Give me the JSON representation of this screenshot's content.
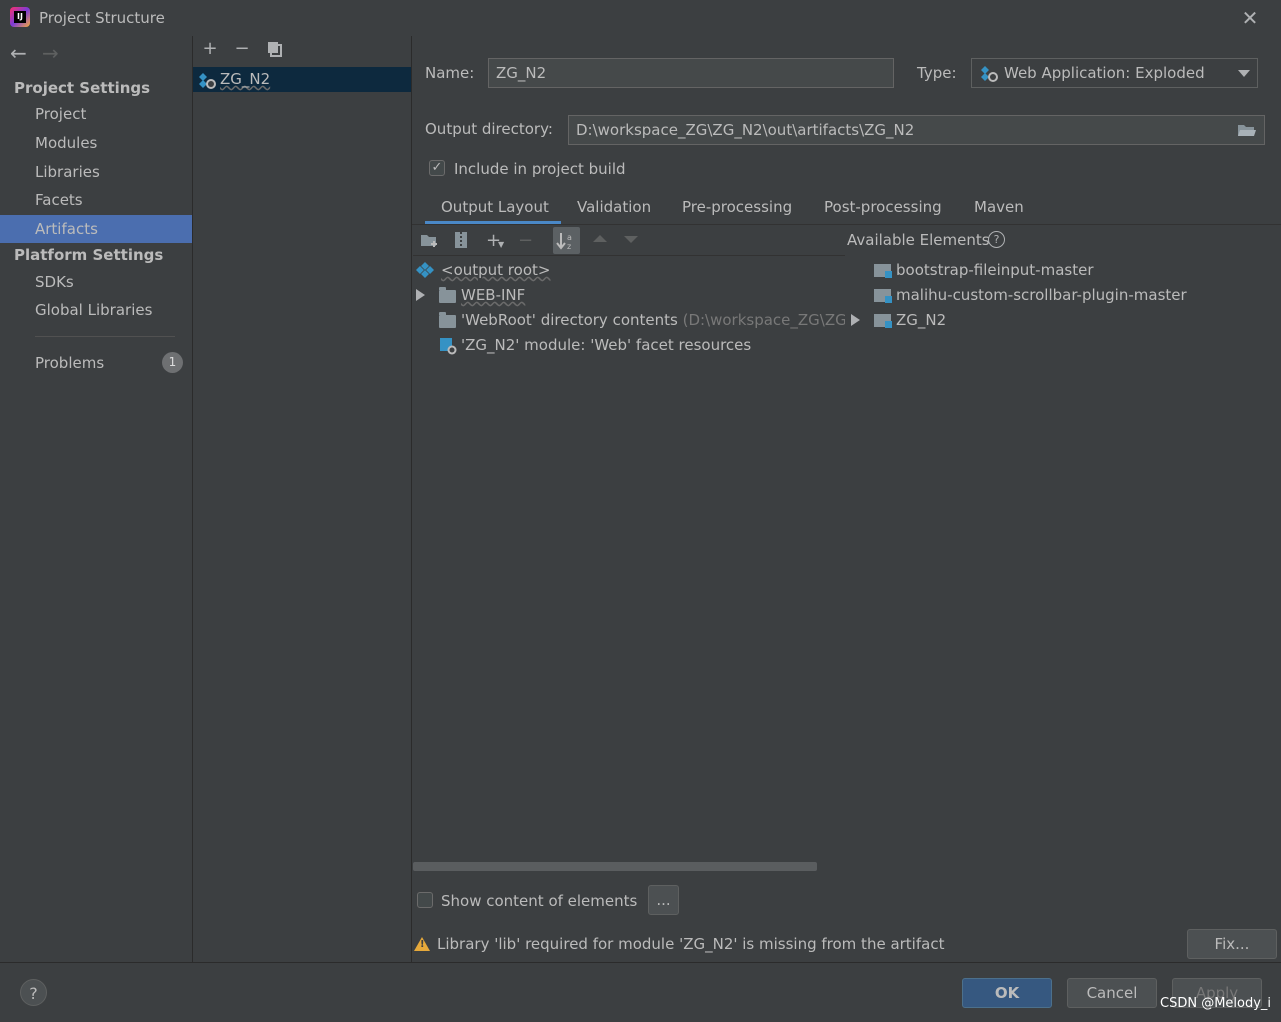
{
  "window": {
    "title": "Project Structure"
  },
  "sidebar": {
    "project_settings_header": "Project Settings",
    "project_items": [
      "Project",
      "Modules",
      "Libraries",
      "Facets",
      "Artifacts"
    ],
    "platform_settings_header": "Platform Settings",
    "platform_items": [
      "SDKs",
      "Global Libraries"
    ],
    "problems_label": "Problems",
    "problems_count": "1"
  },
  "artifacts_list": {
    "items": [
      "ZG_N2"
    ]
  },
  "artifact": {
    "name_label": "Name:",
    "name_value": "ZG_N2",
    "type_label": "Type:",
    "type_value": "Web Application: Exploded",
    "output_dir_label": "Output directory:",
    "output_dir_value": "D:\\workspace_ZG\\ZG_N2\\out\\artifacts\\ZG_N2",
    "include_label": "Include in project build",
    "include_checked": true
  },
  "tabs": [
    "Output Layout",
    "Validation",
    "Pre-processing",
    "Post-processing",
    "Maven"
  ],
  "output_tree": [
    {
      "label": "<output root>",
      "detail": ""
    },
    {
      "label": "WEB-INF",
      "detail": ""
    },
    {
      "label": "'WebRoot' directory contents",
      "detail": " (D:\\workspace_ZG\\ZG_"
    },
    {
      "label": "'ZG_N2' module: 'Web' facet resources",
      "detail": ""
    }
  ],
  "available": {
    "header": "Available Elements",
    "items": [
      "bootstrap-fileinput-master",
      "malihu-custom-scrollbar-plugin-master",
      "ZG_N2"
    ]
  },
  "footer": {
    "show_content_label": "Show content of elements",
    "ellipsis_label": "...",
    "warning_text": "Library 'lib' required for module 'ZG_N2' is missing from the artifact",
    "fix_label": "Fix...",
    "ok_label": "OK",
    "cancel_label": "Cancel",
    "apply_label": "Apply",
    "help_label": "?",
    "watermark": "CSDN @Melody_i"
  },
  "colors": {
    "background": "#3c3f41",
    "selection": "#4b6eaf",
    "accent": "#4a88c7",
    "ok_button": "#365880",
    "warning": "#e6a93b"
  }
}
